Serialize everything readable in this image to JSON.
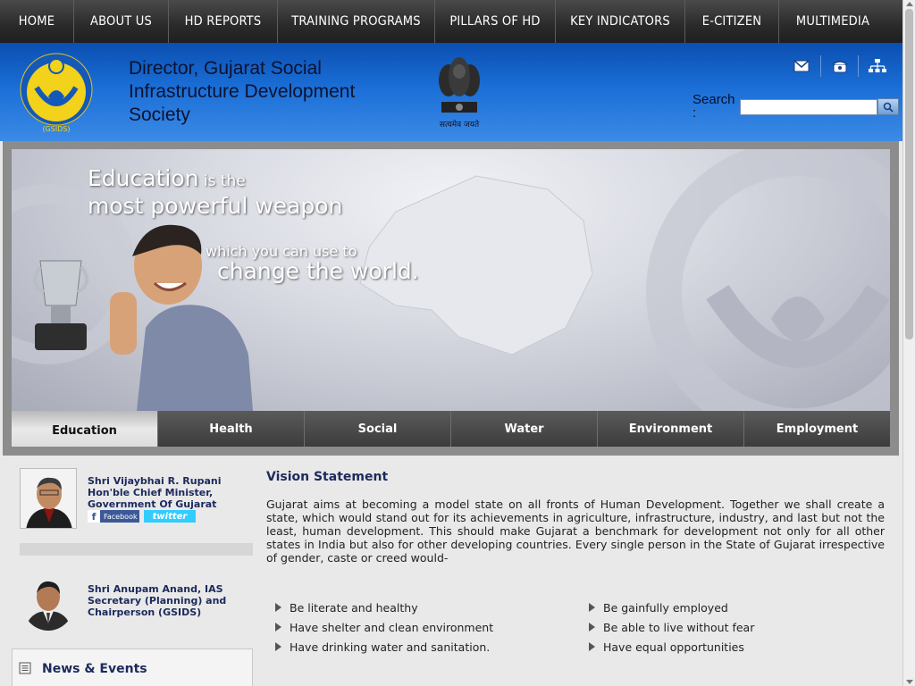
{
  "nav": {
    "items": [
      "HOME",
      "ABOUT US",
      "HD REPORTS",
      "TRAINING PROGRAMS",
      "PILLARS OF HD",
      "KEY INDICATORS",
      "E-CITIZEN",
      "MULTIMEDIA"
    ]
  },
  "header": {
    "org_title": "Director, Gujarat Social Infrastructure Development Society",
    "logo_caption": "(GSIDS)",
    "emblem_caption": "सत्यमेव जयते",
    "search_label": "Search :",
    "search_value": "",
    "icons": [
      "mail-icon",
      "phone-icon",
      "sitemap-icon"
    ]
  },
  "banner": {
    "line1_big": "Education",
    "line1_small": " is the",
    "line2": "most powerful weapon",
    "line3": "which you can use to",
    "line4": "change the world."
  },
  "tabs": [
    "Education",
    "Health",
    "Social",
    "Water",
    "Environment",
    "Employment"
  ],
  "active_tab": "Education",
  "people": [
    {
      "line1": "Shri Vijaybhai R. Rupani",
      "line2": "Hon'ble Chief Minister,",
      "line3": "Government Of Gujarat"
    },
    {
      "line1": "Shri Anupam Anand, IAS",
      "line2": "Secretary (Planning) and",
      "line3": "Chairperson (GSIDS)"
    }
  ],
  "social": {
    "facebook": "Facebook",
    "facebook_glyph": "f",
    "twitter": "twitter"
  },
  "news": {
    "title": "News & Events"
  },
  "vision": {
    "title": "Vision Statement",
    "text": "Gujarat aims at becoming a model state on all fronts of Human Development. Together we shall create a state, which would stand out for its achievements in agriculture, infrastructure, industry, and last but not the least, human development. This should make Gujarat a benchmark for development not only for all other states in India but also for other developing countries. Every single person in the State of Gujarat irrespective of gender, caste or creed would-",
    "goals_left": [
      "Be literate and healthy",
      "Have shelter and clean environment",
      "Have drinking water and sanitation."
    ],
    "goals_right": [
      "Be gainfully employed",
      "Be able to live without fear",
      "Have equal opportunities"
    ]
  },
  "colors": {
    "header_blue": "#1a6ed6",
    "nav_dark": "#2a2a2a",
    "text_navy": "#1c2a5c"
  }
}
